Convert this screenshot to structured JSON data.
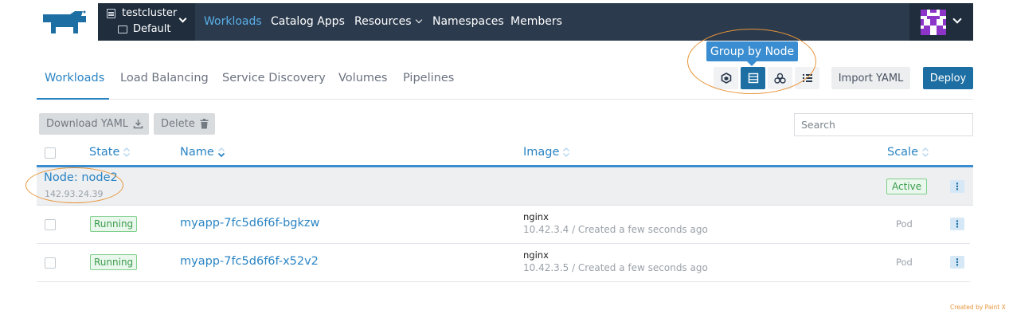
{
  "brand": {
    "logo_icon": "rancher-cow-icon",
    "color": "#1d6fa3"
  },
  "topnav": {
    "cluster_name": "testcluster",
    "project_name": "Default",
    "items": [
      {
        "label": "Workloads",
        "active": true
      },
      {
        "label": "Catalog Apps"
      },
      {
        "label": "Resources",
        "dropdown": true
      },
      {
        "label": "Namespaces"
      },
      {
        "label": "Members"
      }
    ]
  },
  "subtabs": [
    {
      "label": "Workloads",
      "active": true
    },
    {
      "label": "Load Balancing"
    },
    {
      "label": "Service Discovery"
    },
    {
      "label": "Volumes"
    },
    {
      "label": "Pipelines"
    }
  ],
  "grouping": {
    "tooltip": "Group by Node",
    "buttons": [
      {
        "icon": "hexagon-icon"
      },
      {
        "icon": "server-icon",
        "active": true
      },
      {
        "icon": "cluster-icon"
      },
      {
        "icon": "list-icon"
      }
    ]
  },
  "actions": {
    "import_yaml": "Import YAML",
    "deploy": "Deploy"
  },
  "bulk": {
    "download_yaml": "Download YAML",
    "delete": "Delete"
  },
  "search": {
    "placeholder": "Search"
  },
  "table": {
    "headers": {
      "state": "State",
      "name": "Name",
      "image": "Image",
      "scale": "Scale"
    },
    "group": {
      "label": "Node: node2",
      "ip": "142.93.24.39",
      "status": "Active"
    },
    "rows": [
      {
        "state": "Running",
        "name": "myapp-7fc5d6f6f-bgkzw",
        "image": "nginx",
        "meta": "10.42.3.4 / Created a few seconds ago",
        "scale": "Pod"
      },
      {
        "state": "Running",
        "name": "myapp-7fc5d6f6f-x52v2",
        "image": "nginx",
        "meta": "10.42.3.5 / Created a few seconds ago",
        "scale": "Pod"
      }
    ]
  },
  "footer": {
    "credit": "Created by Paint X"
  },
  "colors": {
    "accent": "#2a84c4",
    "topbar": "#2b3a4d",
    "annotation": "#e8953a",
    "success": "#3a9b4c"
  }
}
